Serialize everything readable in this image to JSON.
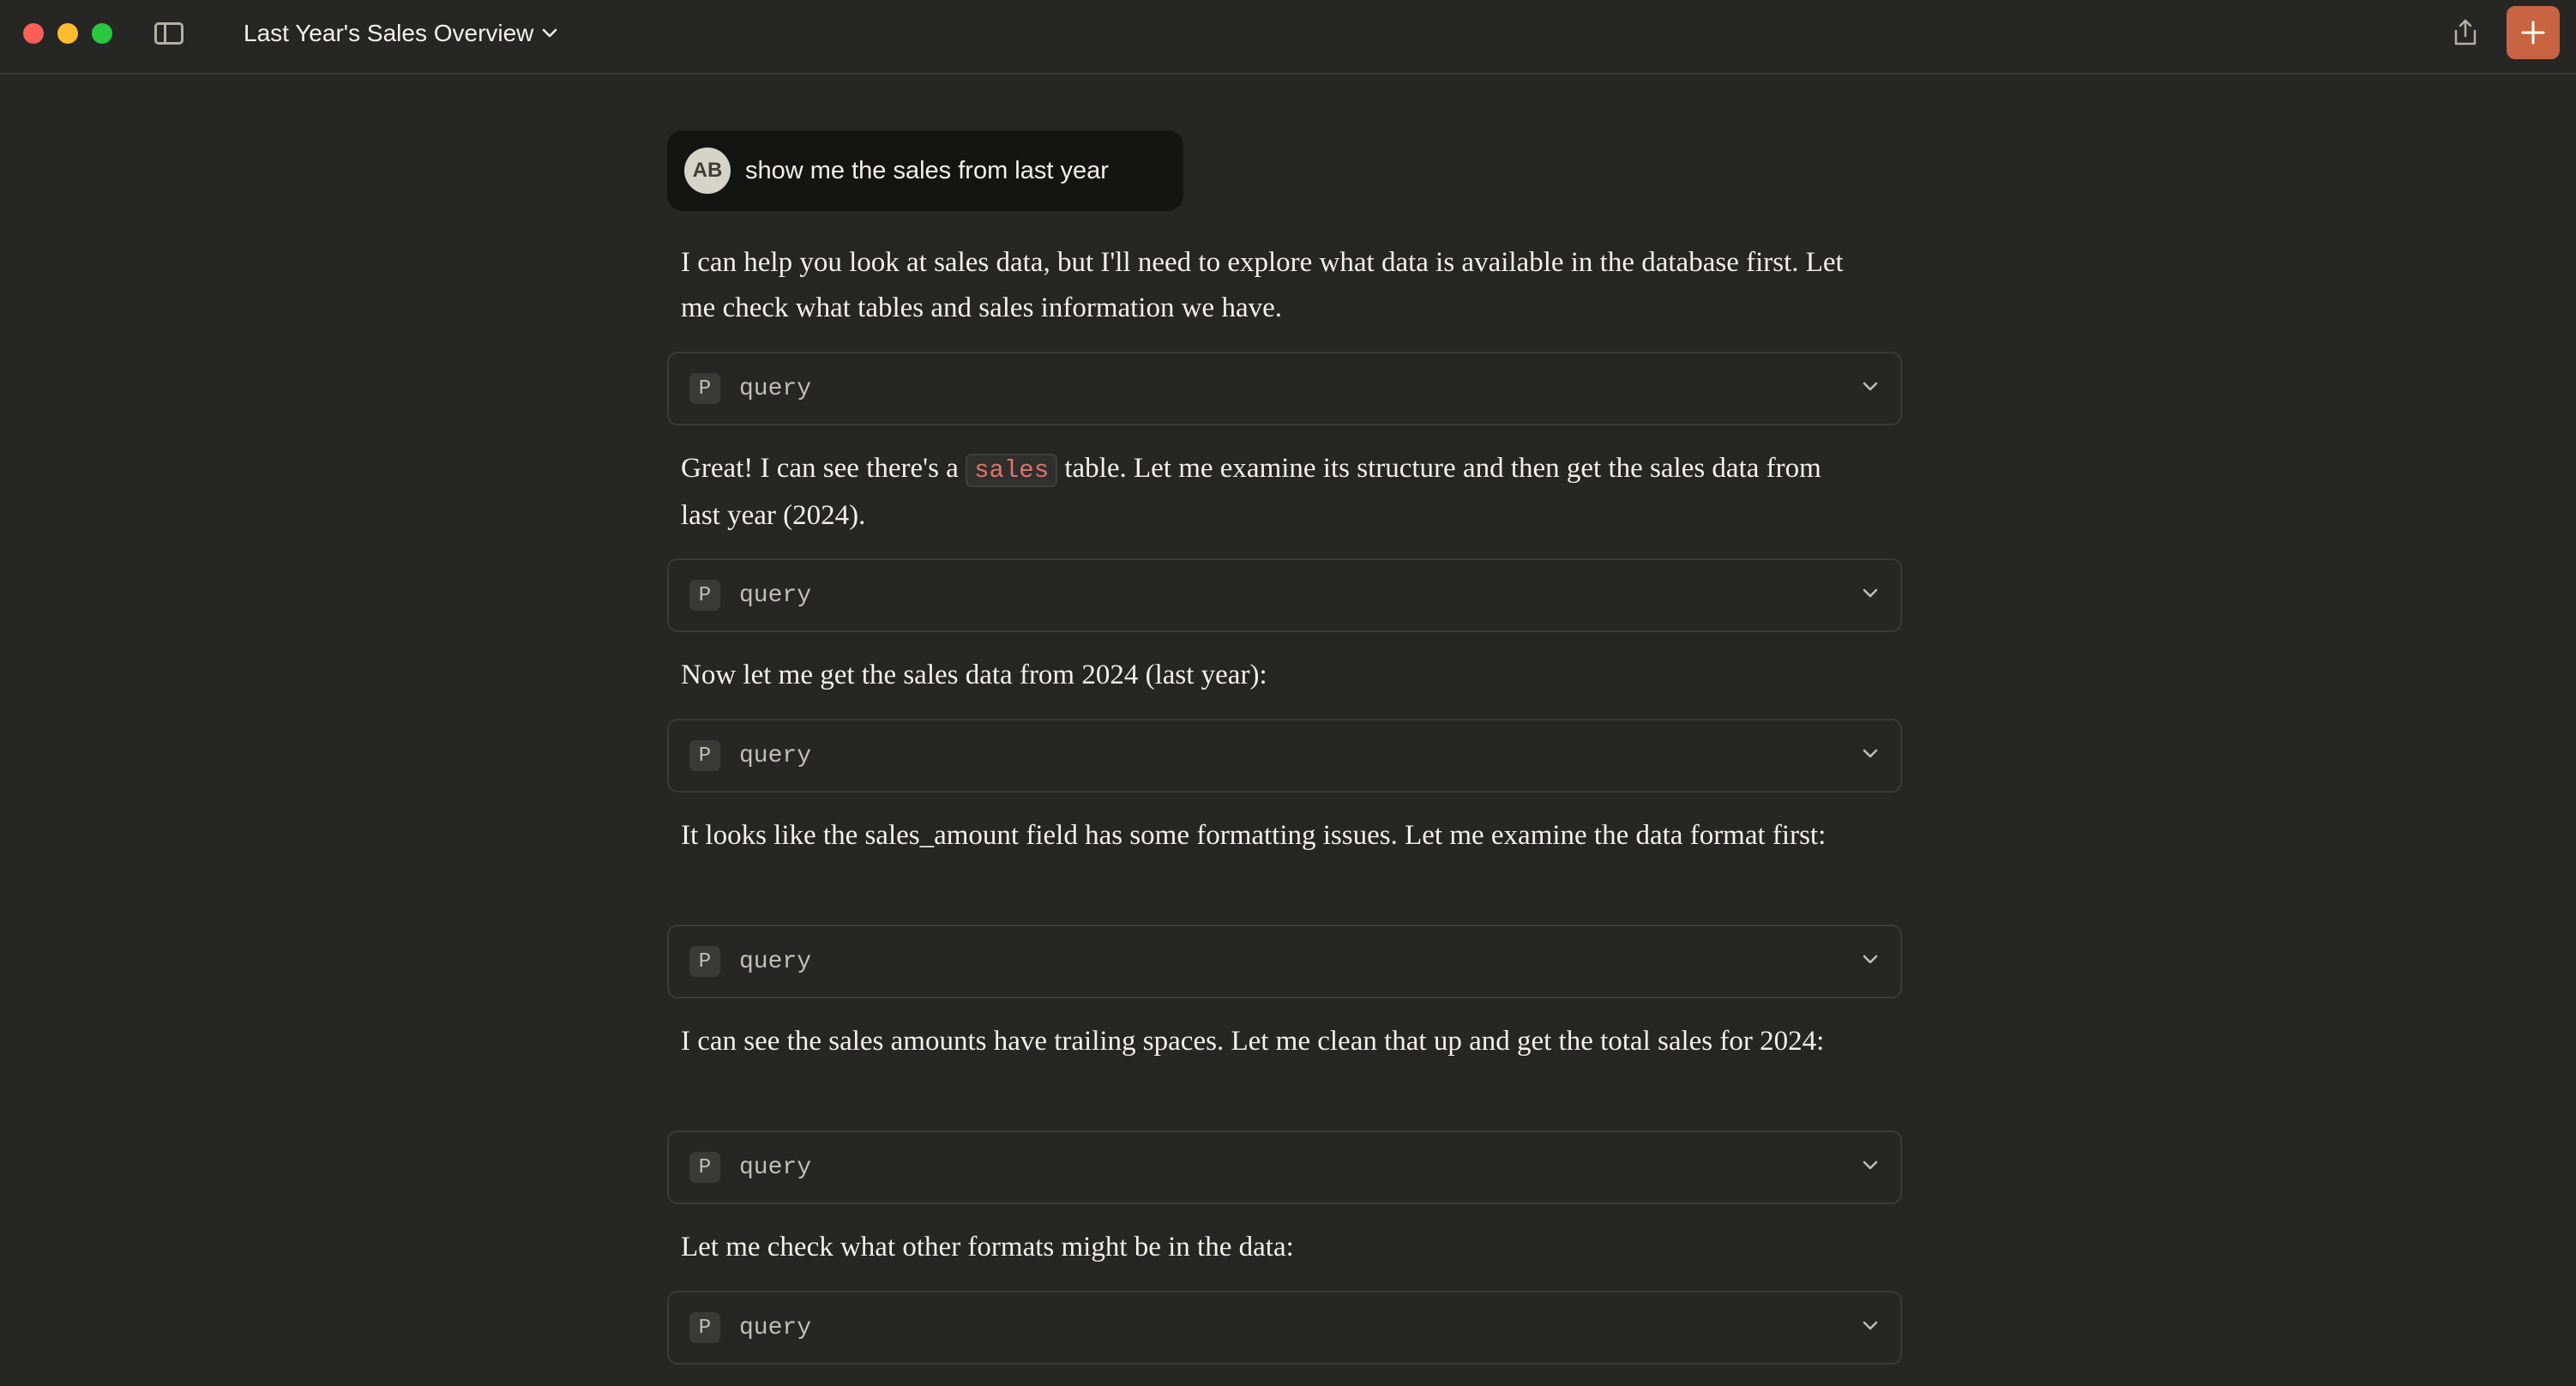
{
  "window": {
    "controls": [
      "close",
      "minimize",
      "maximize"
    ]
  },
  "header": {
    "title": "Last Year's Sales Overview",
    "icons": [
      "sidebar-toggle-icon",
      "chevron-down-icon",
      "share-icon",
      "plus-icon"
    ],
    "accent_color": "#c96442"
  },
  "user_message": {
    "avatar_initials": "AB",
    "text": "show me the sales from last year"
  },
  "messages": [
    {
      "text": "I can help you look at sales data, but I'll need to explore what data is available in the database first. Let me check what tables and sales information we have."
    },
    {
      "text_before": "Great! I can see there's a ",
      "code": "sales",
      "text_after": " table. Let me examine its structure and then get the sales data from last year (2024)."
    },
    {
      "text": "Now let me get the sales data from 2024 (last year):"
    },
    {
      "text": "It looks like the sales_amount field has some formatting issues. Let me examine the data format first:"
    },
    {
      "text": "I can see the sales amounts have trailing spaces. Let me clean that up and get the total sales for 2024:"
    },
    {
      "text": "Let me check what other formats might be in the data:"
    }
  ],
  "tool_calls": [
    {
      "icon_letter": "P",
      "label": "query"
    },
    {
      "icon_letter": "P",
      "label": "query"
    },
    {
      "icon_letter": "P",
      "label": "query"
    },
    {
      "icon_letter": "P",
      "label": "query"
    },
    {
      "icon_letter": "P",
      "label": "query"
    },
    {
      "icon_letter": "P",
      "label": "query"
    }
  ]
}
